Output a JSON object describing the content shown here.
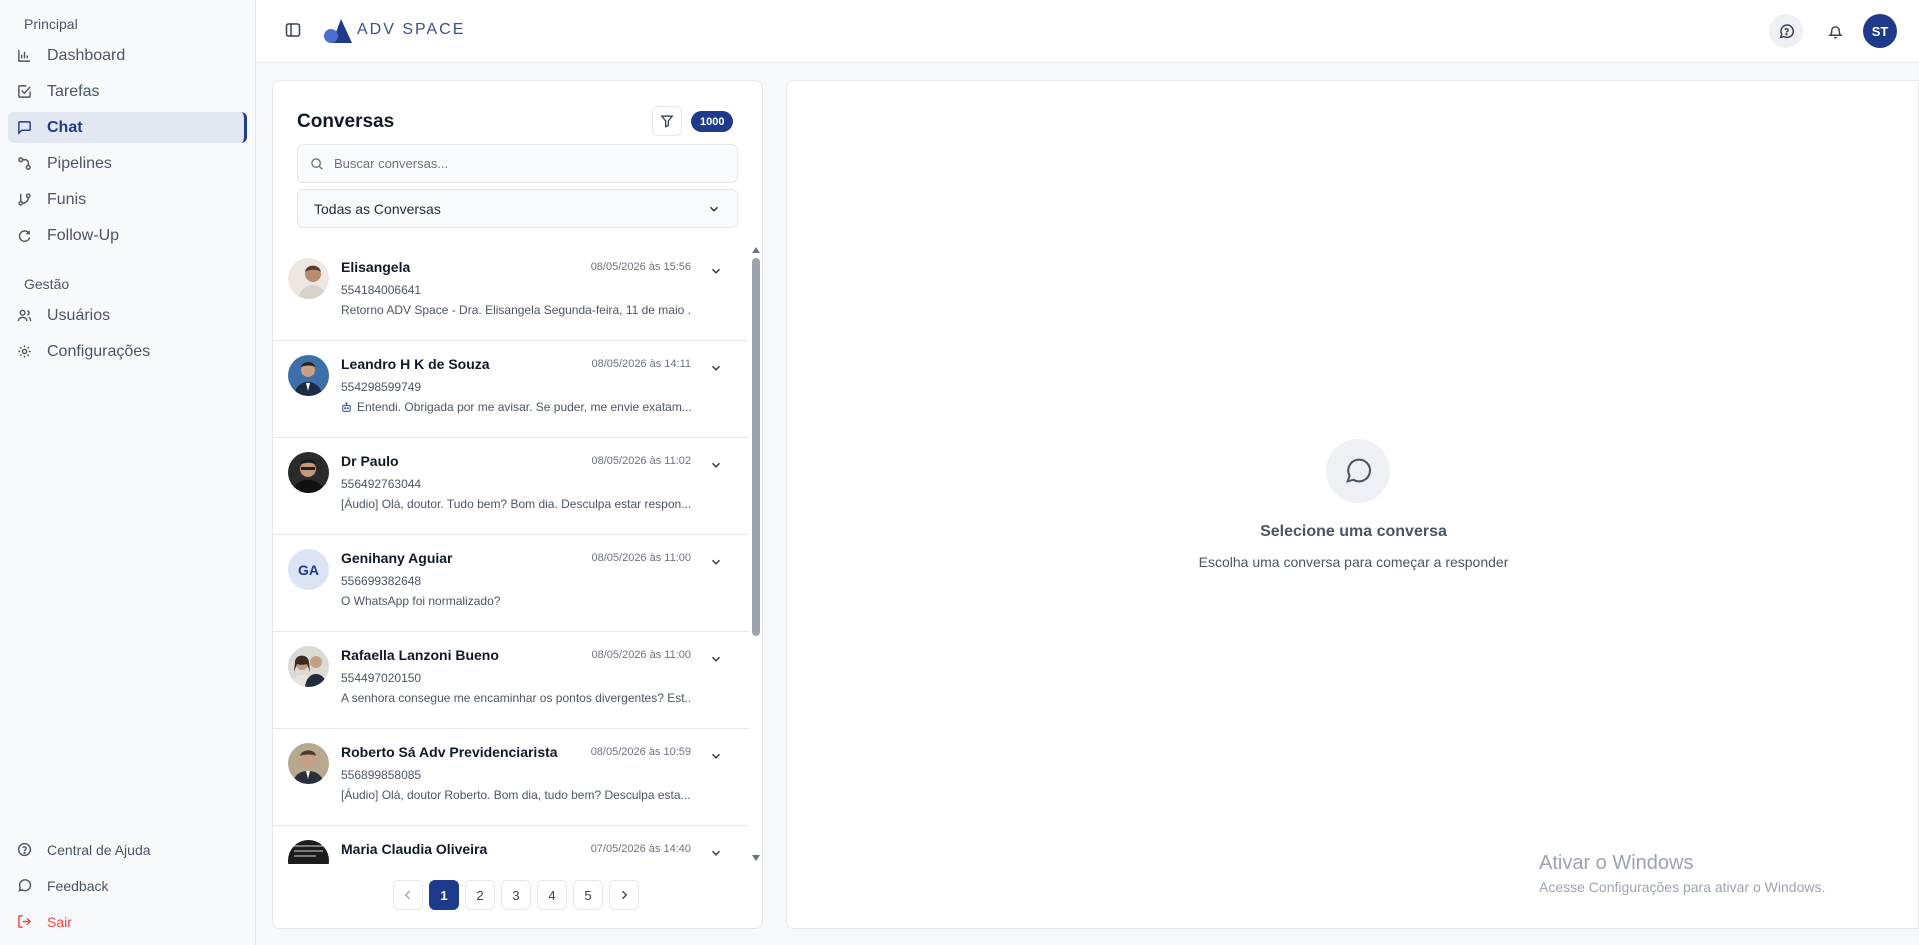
{
  "sidebar": {
    "section_principal": "Principal",
    "section_gestao": "Gestão",
    "items": [
      {
        "label": "Dashboard",
        "icon": "chart-bar-icon"
      },
      {
        "label": "Tarefas",
        "icon": "checkbox-icon"
      },
      {
        "label": "Chat",
        "icon": "message-square-icon",
        "active": true
      },
      {
        "label": "Pipelines",
        "icon": "workflow-icon"
      },
      {
        "label": "Funis",
        "icon": "git-branch-icon"
      },
      {
        "label": "Follow-Up",
        "icon": "refresh-icon"
      },
      {
        "label": "Usuários",
        "icon": "users-icon"
      },
      {
        "label": "Configurações",
        "icon": "gear-icon"
      }
    ],
    "footer": [
      {
        "label": "Central de Ajuda",
        "icon": "help-circle-icon"
      },
      {
        "label": "Feedback",
        "icon": "message-circle-icon"
      },
      {
        "label": "Sair",
        "icon": "logout-icon"
      }
    ]
  },
  "header": {
    "logo_text": "ADV SPACE",
    "avatar_initials": "ST"
  },
  "conversations": {
    "title": "Conversas",
    "count": "1000",
    "search_placeholder": "Buscar conversas...",
    "filter_selected": "Todas as Conversas",
    "items": [
      {
        "name": "Elisangela",
        "date": "08/05/2026 às 15:56",
        "phone": "554184006641",
        "preview": "Retorno ADV Space - Dra. Elisangela Segunda-feira, 11 de maio ...",
        "avatar": "photo"
      },
      {
        "name": "Leandro H K de Souza",
        "date": "08/05/2026 às 14:11",
        "phone": "554298599749",
        "preview": "Entendi. Obrigada por me avisar. Se puder, me envie exatam...",
        "avatar": "photo",
        "bot": true
      },
      {
        "name": "Dr Paulo",
        "date": "08/05/2026 às 11:02",
        "phone": "556492763044",
        "preview": "[Áudio] Olá, doutor. Tudo bem? Bom dia. Desculpa estar respon...",
        "avatar": "photo"
      },
      {
        "name": "Genihany Aguiar",
        "date": "08/05/2026 às 11:00",
        "phone": "556699382648",
        "preview": "O WhatsApp foi normalizado?",
        "avatar": "initials",
        "initials": "GA"
      },
      {
        "name": "Rafaella Lanzoni Bueno",
        "date": "08/05/2026 às 11:00",
        "phone": "554497020150",
        "preview": "A senhora consegue me encaminhar os pontos divergentes? Est...",
        "avatar": "photo"
      },
      {
        "name": "Roberto Sá Adv Previdenciarista",
        "date": "08/05/2026 às 10:59",
        "phone": "556899858085",
        "preview": "[Áudio] Olá, doutor Roberto. Bom dia, tudo bem? Desculpa esta...",
        "avatar": "photo"
      },
      {
        "name": "Maria Claudia Oliveira",
        "date": "07/05/2026 às 14:40",
        "phone": "",
        "preview": "",
        "avatar": "photo"
      }
    ],
    "pages": [
      "1",
      "2",
      "3",
      "4",
      "5"
    ],
    "current_page": "1"
  },
  "detail": {
    "empty_title": "Selecione uma conversa",
    "empty_subtitle": "Escolha uma conversa para começar a responder"
  },
  "watermark": {
    "title": "Ativar o Windows",
    "subtitle": "Acesse Configurações para ativar o Windows."
  },
  "colors": {
    "brand": "#1e3a8a",
    "danger": "#ef4444"
  }
}
